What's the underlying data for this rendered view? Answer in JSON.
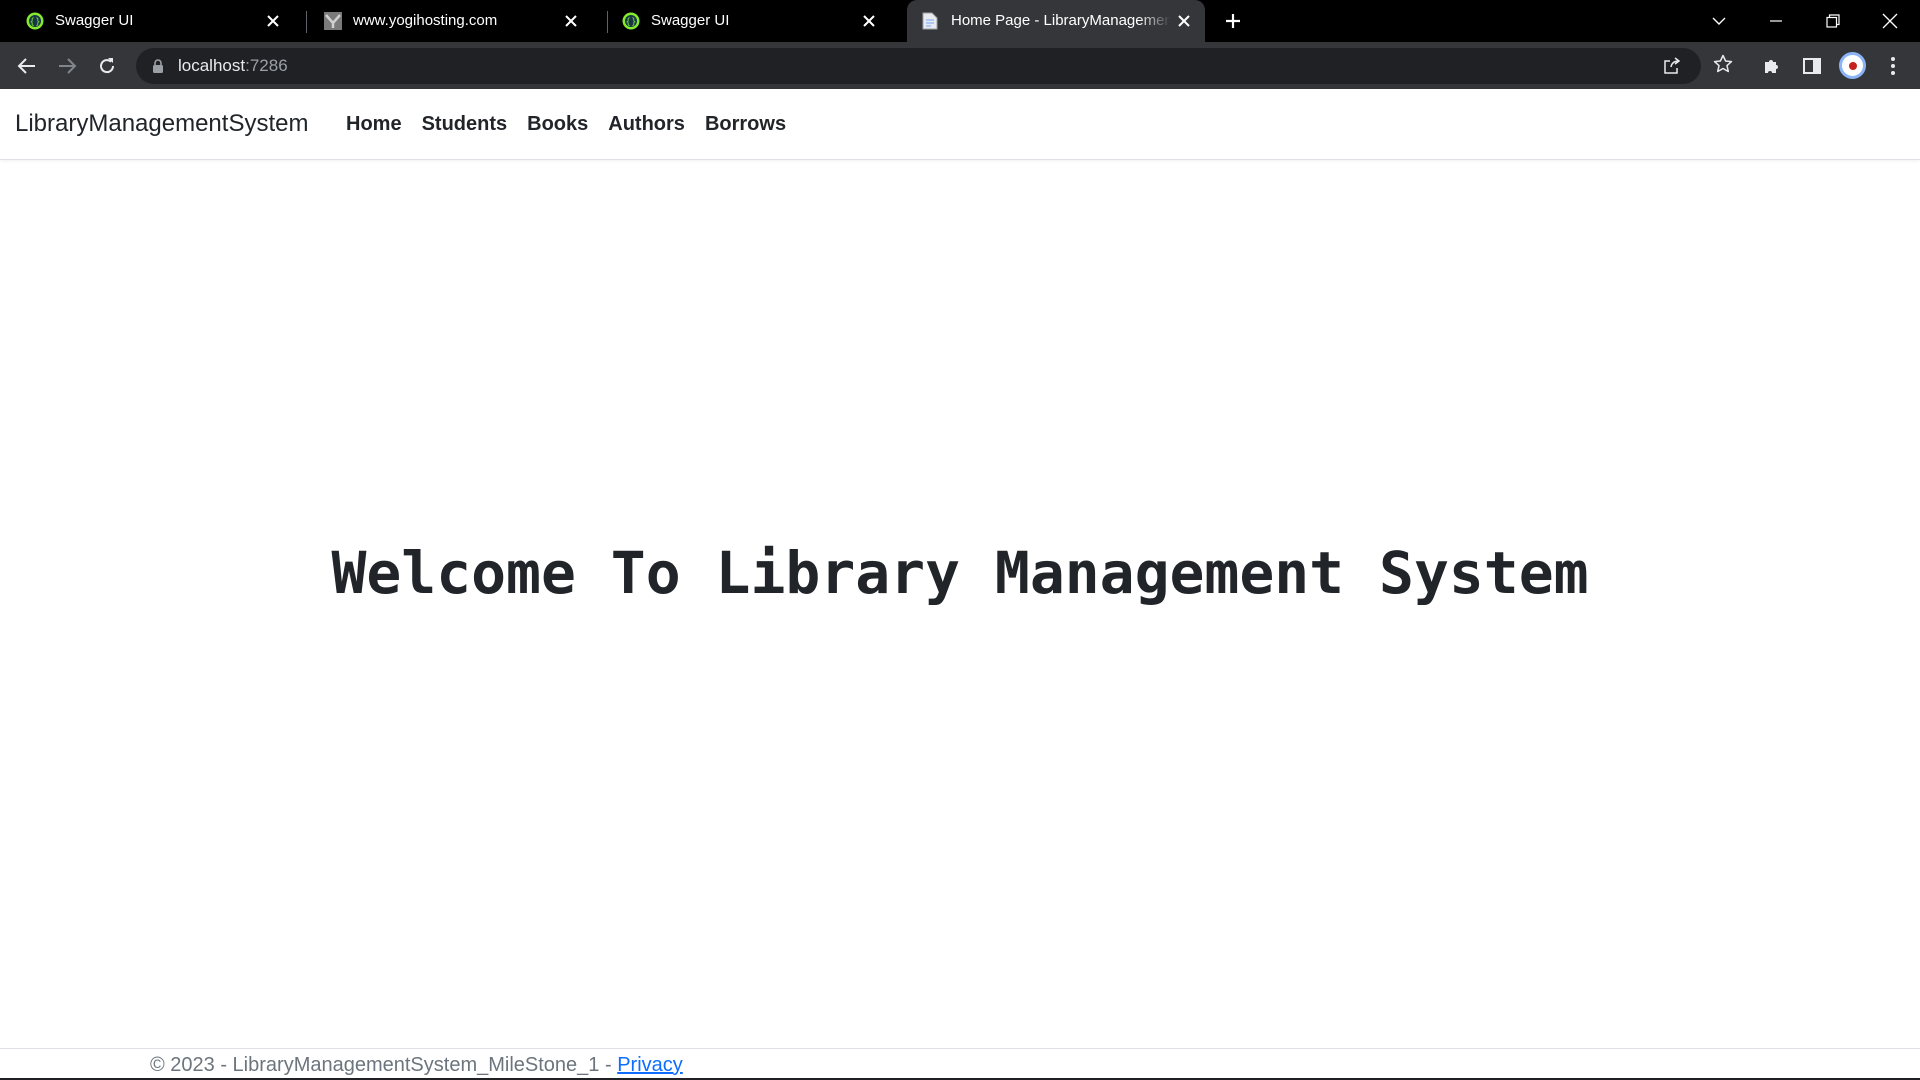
{
  "browser": {
    "tabs": [
      {
        "title": "Swagger UI",
        "icon": "swagger-icon",
        "active": false
      },
      {
        "title": "www.yogihosting.com",
        "icon": "yogihosting-favicon-icon",
        "active": false
      },
      {
        "title": "Swagger UI",
        "icon": "swagger-icon",
        "active": false
      },
      {
        "title": "Home Page - LibraryManagementSystem",
        "icon": "document-icon",
        "active": true
      }
    ],
    "address": {
      "host": "localhost",
      "port": ":7286"
    },
    "colors": {
      "tabstrip": "#000000",
      "toolbar": "#35363a",
      "omnibox": "#202124",
      "swagger_green": "#85ea2d"
    }
  },
  "site": {
    "brand": "LibraryManagementSystem",
    "nav": {
      "home": "Home",
      "students": "Students",
      "books": "Books",
      "authors": "Authors",
      "borrows": "Borrows"
    },
    "hero_title": "Welcome To Library Management System",
    "footer": {
      "text": "© 2023 - LibraryManagementSystem_MileStone_1 - ",
      "link": "Privacy"
    },
    "colors": {
      "text": "#212529",
      "link": "#0d6efd",
      "muted": "#6c757d"
    }
  }
}
